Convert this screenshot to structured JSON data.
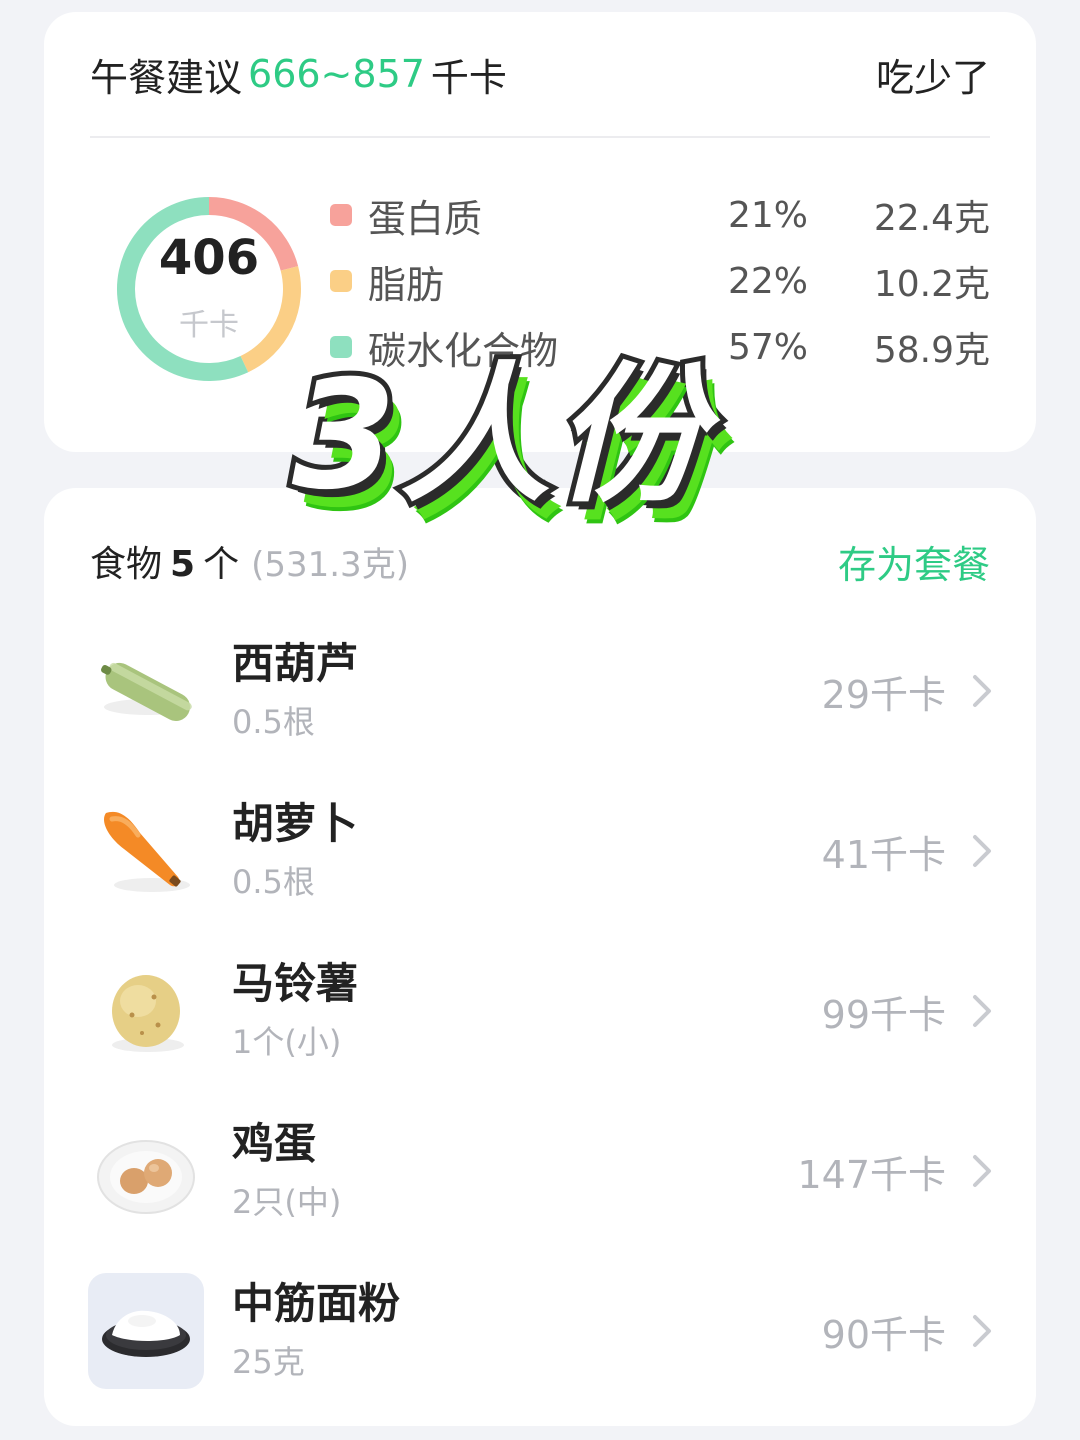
{
  "summary": {
    "title_prefix": "午餐建议",
    "kcal_range": "666~857",
    "title_suffix": "千卡",
    "feedback_label": "吃少了",
    "total_kcal": "406",
    "total_unit": "千卡",
    "macros": [
      {
        "name": "蛋白质",
        "percent": "21%",
        "grams": "22.4克",
        "color": "#f7a29b",
        "share": 21
      },
      {
        "name": "脂肪",
        "percent": "22%",
        "grams": "10.2克",
        "color": "#fbcf86",
        "share": 22
      },
      {
        "name": "碳水化合物",
        "percent": "57%",
        "grams": "58.9克",
        "color": "#8ee0bf",
        "share": 57
      }
    ]
  },
  "overlay": {
    "text": "3人份"
  },
  "foods": {
    "title": "食物",
    "count": "5",
    "count_unit": "个",
    "total_weight": "(531.3克)",
    "save_label": "存为套餐",
    "items": [
      {
        "name": "西葫芦",
        "amount": "0.5根",
        "kcal": "29千卡",
        "icon": "zucchini-icon"
      },
      {
        "name": "胡萝卜",
        "amount": "0.5根",
        "kcal": "41千卡",
        "icon": "carrot-icon"
      },
      {
        "name": "马铃薯",
        "amount": "1个(小)",
        "kcal": "99千卡",
        "icon": "potato-icon"
      },
      {
        "name": "鸡蛋",
        "amount": "2只(中)",
        "kcal": "147千卡",
        "icon": "egg-icon"
      },
      {
        "name": "中筋面粉",
        "amount": "25克",
        "kcal": "90千卡",
        "icon": "flour-icon"
      }
    ]
  }
}
